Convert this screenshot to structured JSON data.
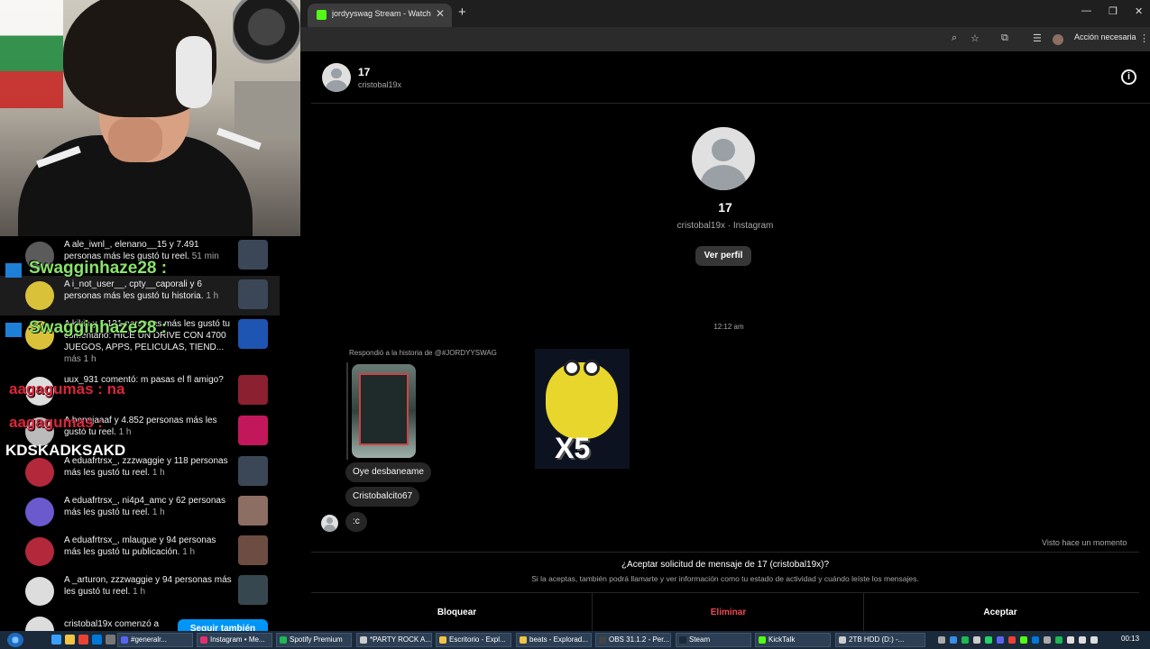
{
  "stream_overlay": {
    "notifications": [
      {
        "text": "A ale_iwnl_, elenano__15 y 7.491 personas más les gustó tu reel.",
        "time": "51 min"
      },
      {
        "text": "A i_not_user__, cpty__caporali y 6 personas más les gustó tu historia.",
        "time": "1 h"
      },
      {
        "text": "A kikin y 4,131 personas más les gustó tu comentario: HICE UN DRIVE CON 4700 JUEGOS, APPS, PELICULAS, TIEND...",
        "time": "más 1 h"
      },
      {
        "text": "uux_931 comentó: m pasas el fl amigo?",
        "time": ""
      },
      {
        "text": "A bennjaaaf y 4.852 personas más les gustó tu reel.",
        "time": "1 h"
      },
      {
        "text": "A eduafrtrsx_, zzzwaggie y 118 personas más les gustó tu reel.",
        "time": "1 h"
      },
      {
        "text": "A eduafrtrsx_, ni4p4_amc y 62 personas más les gustó tu reel.",
        "time": "1 h"
      },
      {
        "text": "A eduafrtrsx_, mlaugue y 94 personas más les gustó tu publicación.",
        "time": "1 h"
      },
      {
        "text": "A _arturon, zzzwaggie y 94 personas más les gustó tu reel.",
        "time": "1 h"
      },
      {
        "text": "cristobal19x comenzó a",
        "time": ""
      }
    ],
    "follow_back_label": "Seguir también",
    "chat_overlays": [
      {
        "text": "Swagginhaze28 :",
        "style": "green"
      },
      {
        "text": "Swagginhaze28 :",
        "style": "green"
      },
      {
        "text": "aagagumas : na",
        "style": "red"
      },
      {
        "text": "aagagumas :",
        "style": "red"
      },
      {
        "text": "KDSKADKSAKD",
        "style": "white"
      }
    ]
  },
  "browser": {
    "tab_title": "jordyyswag Stream - Watch Live",
    "tab_close": "✕",
    "new_tab": "+",
    "window_controls": [
      "—",
      "❐",
      "✕"
    ],
    "action_required": "Acción necesaria",
    "accent": "#53fc18"
  },
  "dm": {
    "header_name": "17",
    "header_username": "cristobal19x",
    "profile_name": "17",
    "profile_sub": "cristobal19x · Instagram",
    "view_profile_label": "Ver perfil",
    "timestamp": "12:12 am",
    "reply_label": "Respondió a la historia de @#JORDYYSWAG",
    "messages": [
      "Oye desbaneame",
      "Cristobalcito67",
      ":c"
    ],
    "sticker_label": "X5",
    "seen_label": "Visto hace un momento",
    "request_title": "¿Aceptar solicitud de mensaje de 17 (cristobal19x)?",
    "request_desc": "Si la aceptas, también podrá llamarte y ver información como tu estado de actividad y cuándo leíste los mensajes.",
    "block_label": "Bloquear",
    "delete_label": "Eliminar",
    "accept_label": "Aceptar",
    "delete_color": "#ed4956",
    "info_icon_glyph": "i"
  },
  "taskbar": {
    "tasks": [
      {
        "label": "#generalr...",
        "color": "#5865f2"
      },
      {
        "label": "Instagram • Me...",
        "color": "#e1306c"
      },
      {
        "label": "Spotify Premium",
        "color": "#1db954"
      },
      {
        "label": "*PARTY ROCK A...",
        "color": "#cccccc"
      },
      {
        "label": "Escritorio - Expl...",
        "color": "#f3c343"
      },
      {
        "label": "beats - Explorad...",
        "color": "#f3c343"
      },
      {
        "label": "OBS 31.1.2 - Per...",
        "color": "#444444"
      },
      {
        "label": "Steam",
        "color": "#1b2838"
      },
      {
        "label": "KickTalk",
        "color": "#53fc18"
      },
      {
        "label": "2TB HDD (D:) -...",
        "color": "#cccccc"
      }
    ],
    "clock": "00:13"
  }
}
